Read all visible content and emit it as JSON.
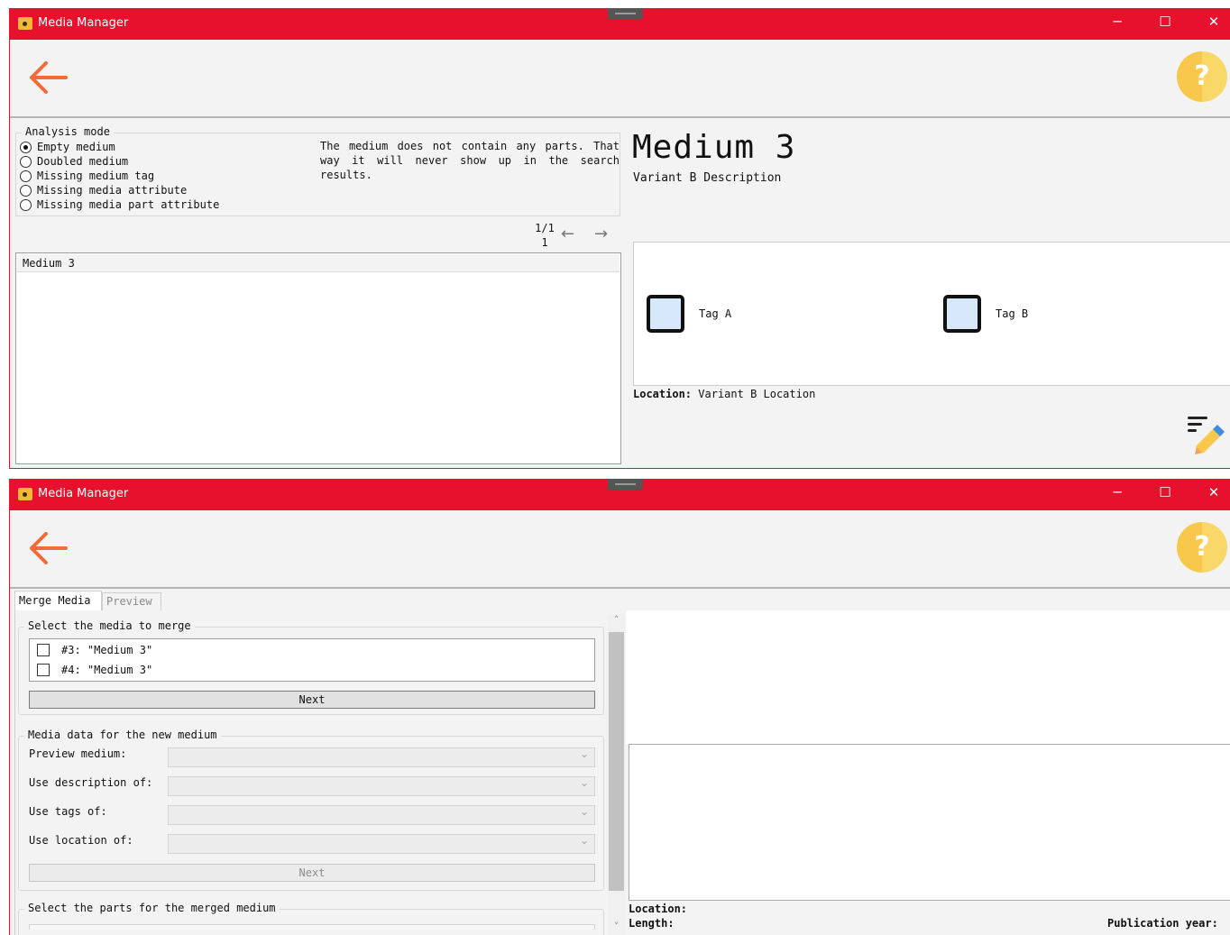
{
  "windows": [
    {
      "title": "Media Manager",
      "controls": {
        "minimize": "─",
        "maximize": "☐",
        "close": "✕"
      },
      "help": "?",
      "analysis": {
        "group_label": "Analysis mode",
        "modes": [
          {
            "label": "Empty medium",
            "selected": true
          },
          {
            "label": "Doubled medium",
            "selected": false
          },
          {
            "label": "Missing medium tag",
            "selected": false
          },
          {
            "label": "Missing media attribute",
            "selected": false
          },
          {
            "label": "Missing media part attribute",
            "selected": false
          }
        ],
        "description": "The medium does not contain any parts. That way it will never show up in the search results."
      },
      "pager": {
        "page": "1/1",
        "count": "1",
        "prev": "←",
        "next": "→"
      },
      "results": [
        "Medium 3"
      ],
      "detail": {
        "title": "Medium 3",
        "description": "Variant B Description",
        "tags": [
          "Tag A",
          "Tag B"
        ],
        "location_label": "Location:",
        "location_value": "Variant B Location"
      }
    },
    {
      "title": "Media Manager",
      "controls": {
        "minimize": "─",
        "maximize": "☐",
        "close": "✕"
      },
      "help": "?",
      "tabs": [
        "Merge Media",
        "Preview"
      ],
      "merge": {
        "select_label": "Select the media to merge",
        "media": [
          {
            "id": "#3:",
            "name": "\"Medium 3\"",
            "checked": false
          },
          {
            "id": "#4:",
            "name": "\"Medium 3\"",
            "checked": false
          }
        ],
        "next_label": "Next",
        "data_label": "Media data for the new medium",
        "fields": [
          {
            "label": "Preview medium:",
            "value": ""
          },
          {
            "label": "Use description of:",
            "value": ""
          },
          {
            "label": "Use tags of:",
            "value": ""
          },
          {
            "label": "Use location of:",
            "value": ""
          }
        ],
        "next2_label": "Next",
        "parts_label": "Select the parts for the merged medium"
      },
      "scroll": {
        "up": "˄",
        "down": "˅"
      },
      "preview_meta": {
        "location_label": "Location:",
        "length_label": "Length:",
        "year_label": "Publication year:"
      }
    }
  ],
  "colors": {
    "titlebar": "#e8112d",
    "accent_orange": "#f26b3a",
    "help_yellow": "#f7c84c"
  }
}
